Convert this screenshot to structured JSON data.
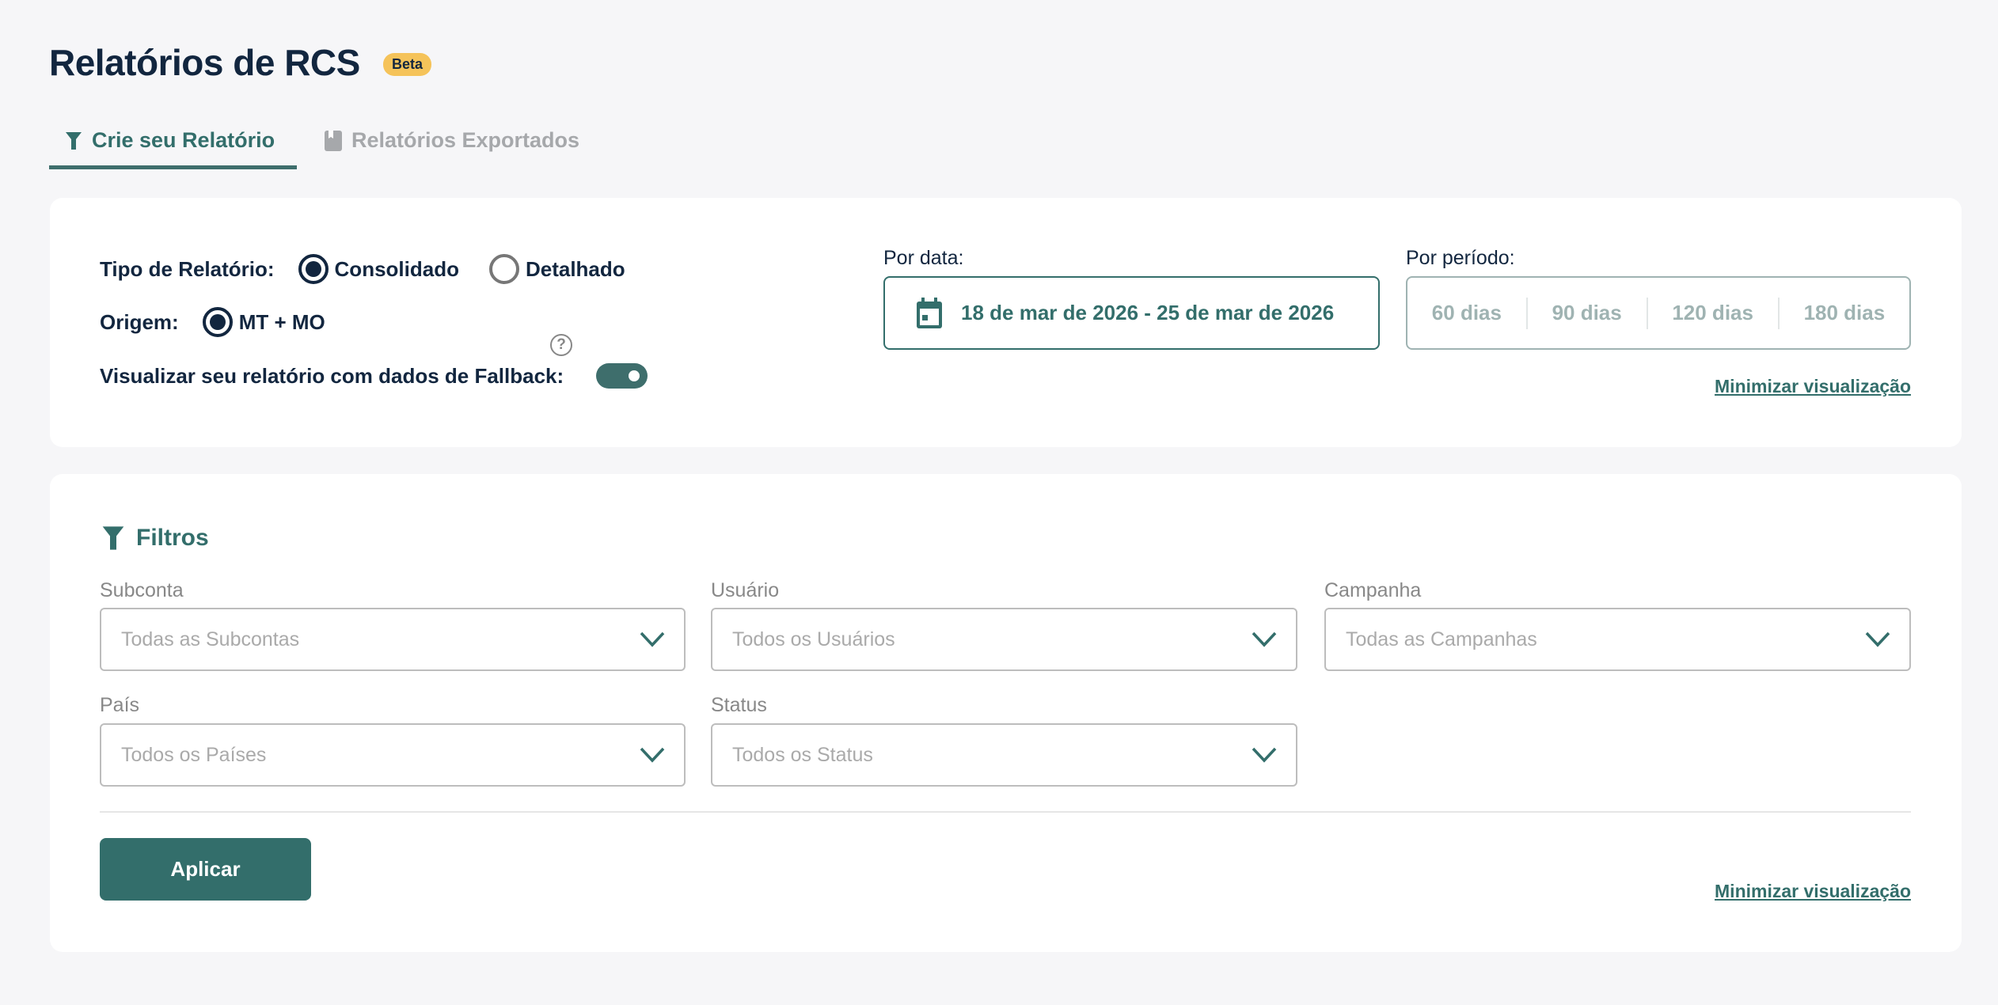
{
  "header": {
    "title": "Relatórios de RCS",
    "badge": "Beta"
  },
  "tabs": [
    {
      "label": "Crie seu Relatório",
      "icon": "funnel-icon",
      "active": true
    },
    {
      "label": "Relatórios Exportados",
      "icon": "book-icon",
      "active": false
    }
  ],
  "report": {
    "type_label": "Tipo de Relatório:",
    "type_options": [
      {
        "label": "Consolidado",
        "selected": true
      },
      {
        "label": "Detalhado",
        "selected": false
      }
    ],
    "origin_label": "Origem:",
    "origin_option": {
      "label": "MT + MO",
      "selected": true
    },
    "fallback_label": "Visualizar seu relatório com dados de Fallback:",
    "fallback_help": "?",
    "fallback_enabled": true,
    "date_label": "Por data:",
    "date_range": "18 de mar de 2026 - 25 de mar de 2026",
    "period_label": "Por período:",
    "periods": [
      "60 dias",
      "90 dias",
      "120 dias",
      "180 dias"
    ],
    "minimize": "Minimizar visualização"
  },
  "filters": {
    "title": "Filtros",
    "fields": [
      {
        "label": "Subconta",
        "placeholder": "Todas as Subcontas"
      },
      {
        "label": "Usuário",
        "placeholder": "Todos os Usuários"
      },
      {
        "label": "Campanha",
        "placeholder": "Todas as Campanhas"
      },
      {
        "label": "País",
        "placeholder": "Todos os Países"
      },
      {
        "label": "Status",
        "placeholder": "Todos os Status"
      }
    ],
    "apply": "Aplicar",
    "minimize": "Minimizar visualização"
  },
  "colors": {
    "accent": "#336e6b",
    "text": "#12263f",
    "badge": "#f5c35a",
    "background": "#f6f6f8"
  }
}
